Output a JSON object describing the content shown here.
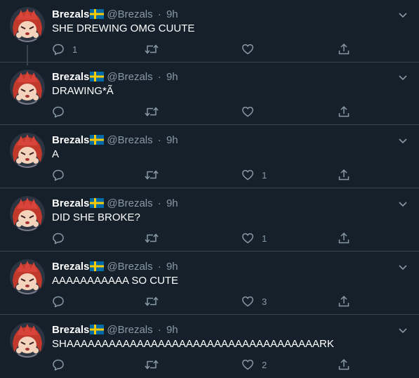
{
  "tweets": [
    {
      "name": "Brezals",
      "handle": "@Brezals",
      "dot": "·",
      "time": "9h",
      "text": "SHE DREWING OMG CUUTE",
      "replies": "1",
      "retweets": "",
      "likes": ""
    },
    {
      "name": "Brezals",
      "handle": "@Brezals",
      "dot": "·",
      "time": "9h",
      "text": "DRAWING*Ã",
      "replies": "",
      "retweets": "",
      "likes": ""
    },
    {
      "name": "Brezals",
      "handle": "@Brezals",
      "dot": "·",
      "time": "9h",
      "text": "A",
      "replies": "",
      "retweets": "",
      "likes": "1"
    },
    {
      "name": "Brezals",
      "handle": "@Brezals",
      "dot": "·",
      "time": "9h",
      "text": "DID SHE BROKE?",
      "replies": "",
      "retweets": "",
      "likes": "1"
    },
    {
      "name": "Brezals",
      "handle": "@Brezals",
      "dot": "·",
      "time": "9h",
      "text": "AAAAAAAAAAA SO CUTE",
      "replies": "",
      "retweets": "",
      "likes": "3"
    },
    {
      "name": "Brezals",
      "handle": "@Brezals",
      "dot": "·",
      "time": "9h",
      "text": "SHAAAAAAAAAAAAAAAAAAAAAAAAAAAAAAAAAAAARK",
      "replies": "",
      "retweets": "",
      "likes": "2"
    }
  ],
  "icons": {
    "flag": "sweden-flag-icon",
    "caret": "chevron-down-icon",
    "reply": "reply-icon",
    "retweet": "retweet-icon",
    "like": "heart-icon",
    "share": "share-icon"
  },
  "colors": {
    "background": "#15202b",
    "divider": "#38444d",
    "secondary_text": "#8899a6",
    "primary_text": "#ffffff"
  }
}
